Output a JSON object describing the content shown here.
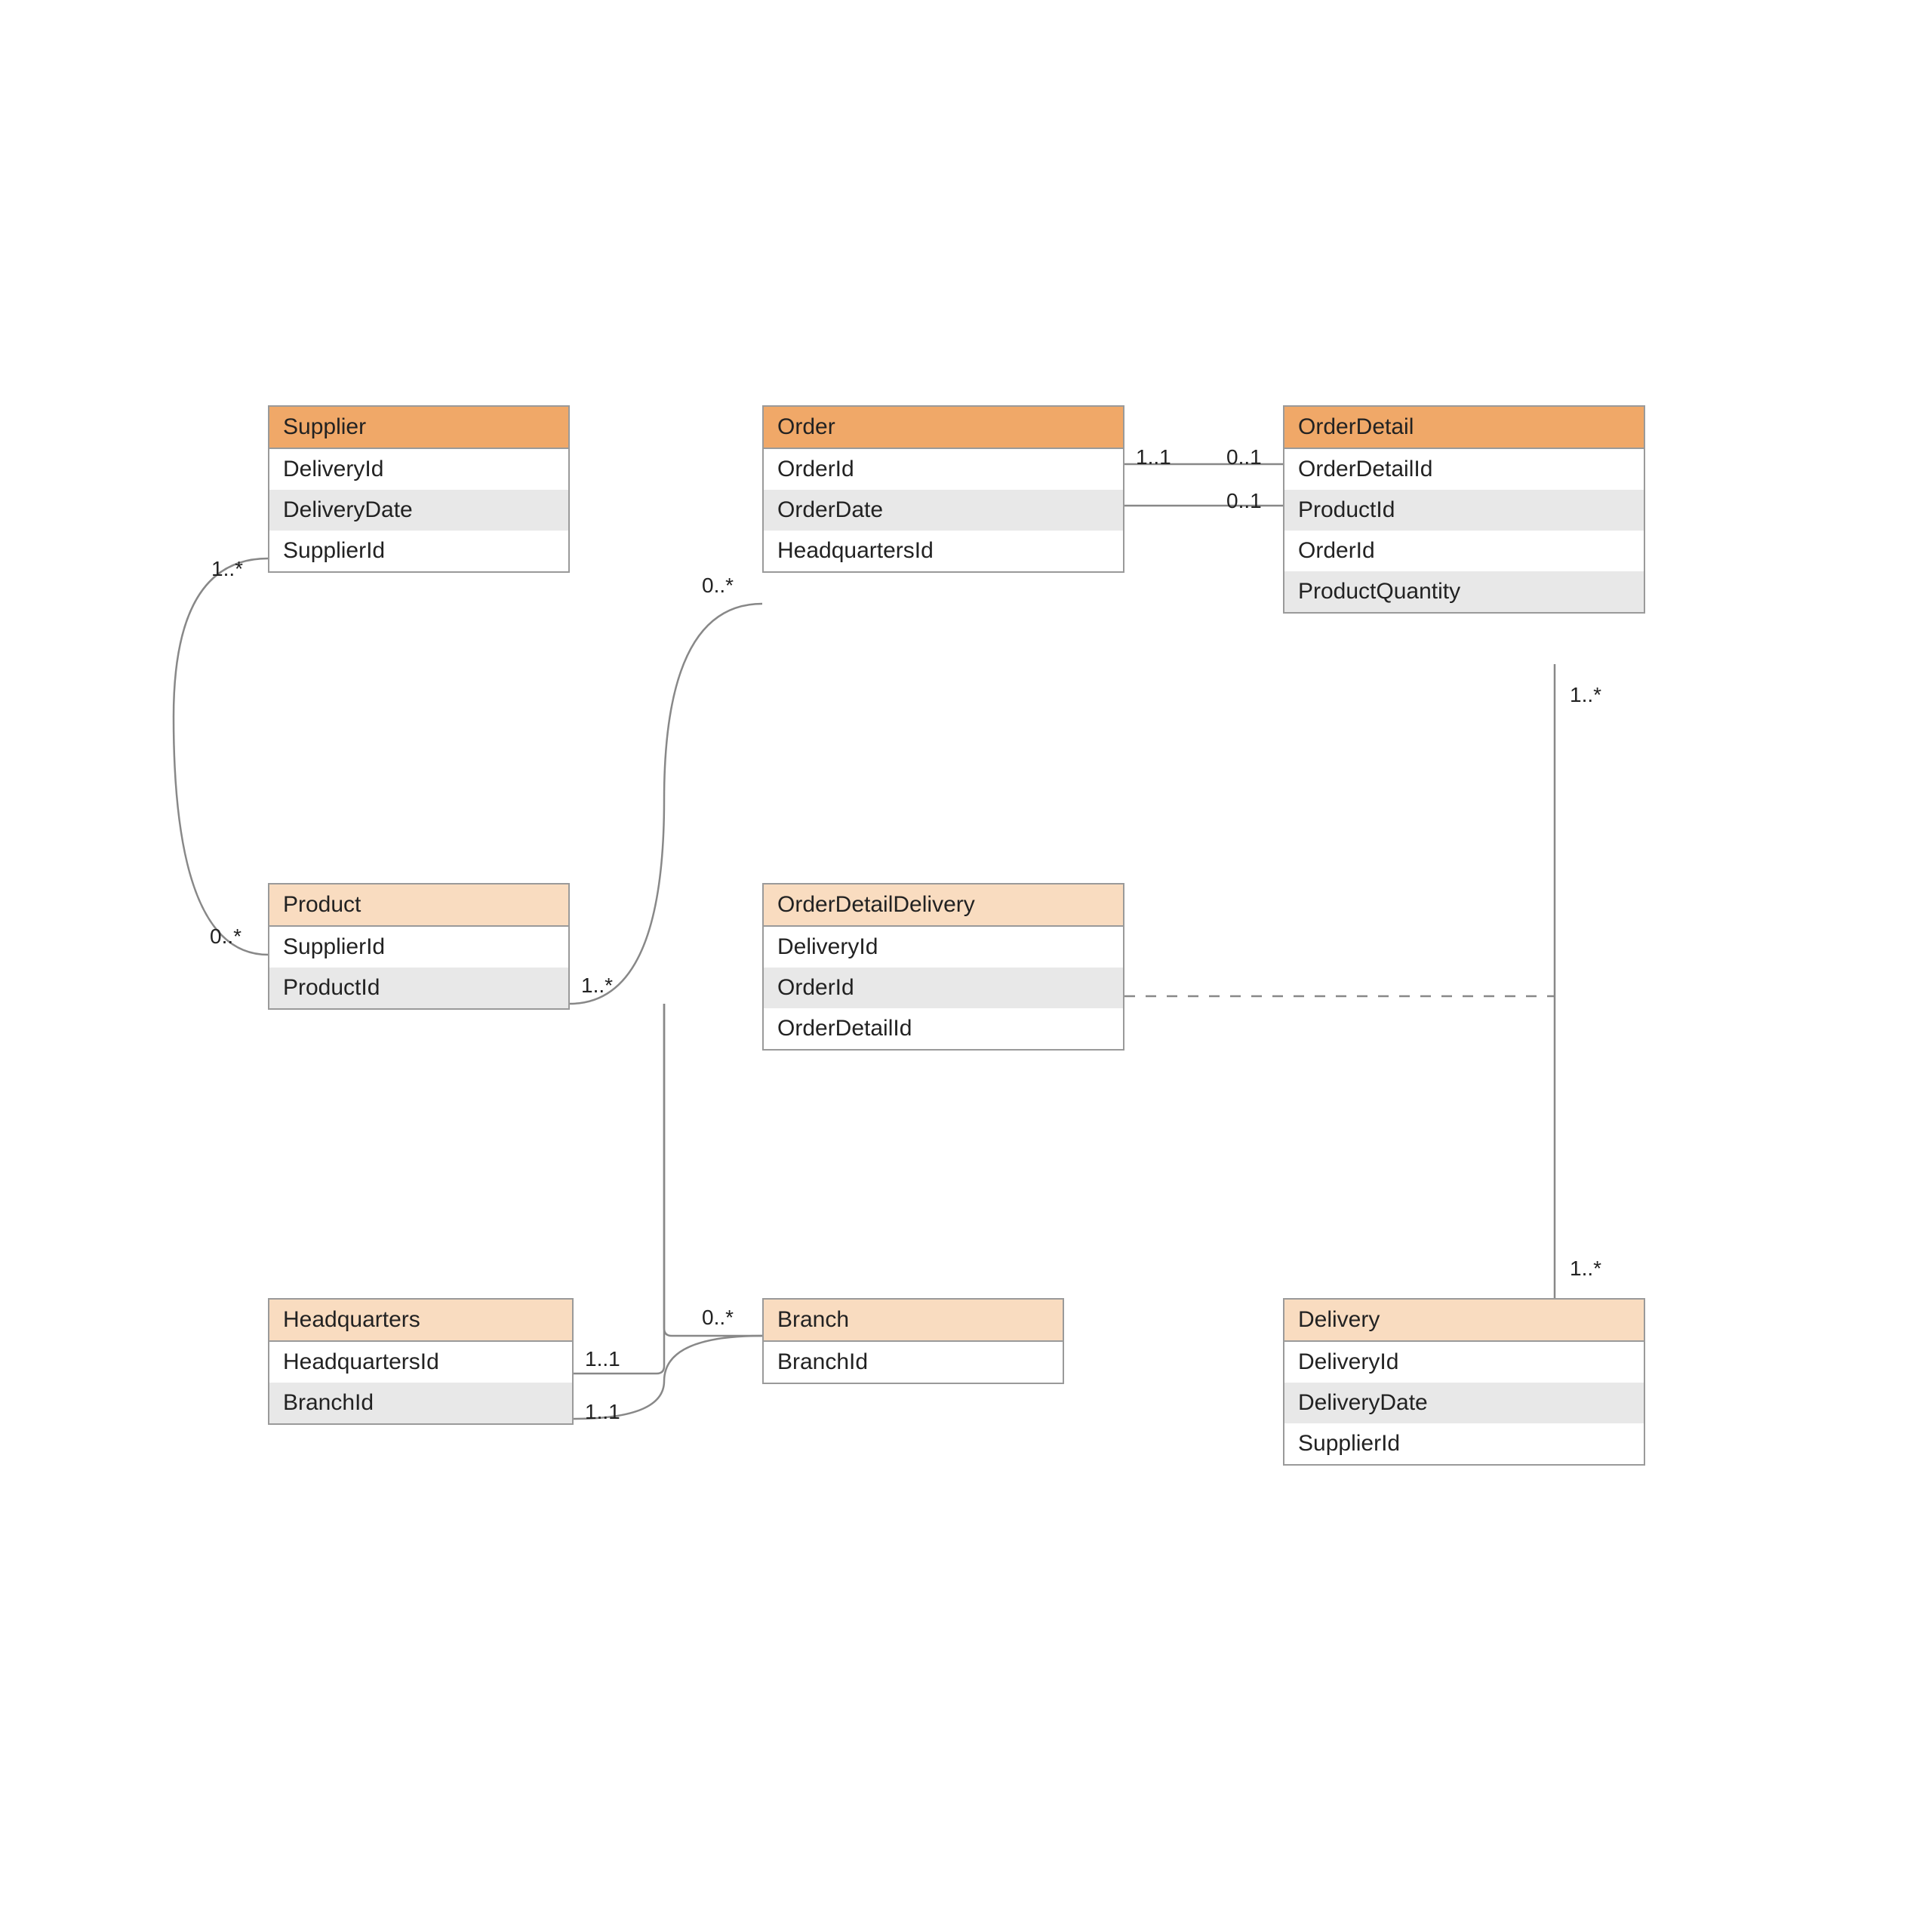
{
  "entities": {
    "supplier": {
      "title": "Supplier",
      "attrs": [
        "DeliveryId",
        "DeliveryDate",
        "SupplierId"
      ]
    },
    "order": {
      "title": "Order",
      "attrs": [
        "OrderId",
        "OrderDate",
        "HeadquartersId"
      ]
    },
    "orderDetail": {
      "title": "OrderDetail",
      "attrs": [
        "OrderDetailId",
        "ProductId",
        "OrderId",
        "ProductQuantity"
      ]
    },
    "product": {
      "title": "Product",
      "attrs": [
        "SupplierId",
        "ProductId"
      ]
    },
    "orderDetailDelivery": {
      "title": "OrderDetailDelivery",
      "attrs": [
        "DeliveryId",
        "OrderId",
        "OrderDetailId"
      ]
    },
    "headquarters": {
      "title": "Headquarters",
      "attrs": [
        "HeadquartersId",
        "BranchId"
      ]
    },
    "branch": {
      "title": "Branch",
      "attrs": [
        "BranchId"
      ]
    },
    "delivery": {
      "title": "Delivery",
      "attrs": [
        "DeliveryId",
        "DeliveryDate",
        "SupplierId"
      ]
    }
  },
  "multiplicities": {
    "supplier_product_1": "1..*",
    "supplier_product_2": "0..*",
    "product_order_1": "1..*",
    "product_order_2": "0..*",
    "order_orderDetail_1": "1..1",
    "order_orderDetail_2": "0..1",
    "order_orderDetail_3": "0..1",
    "orderDetail_delivery_1": "1..*",
    "orderDetail_delivery_2": "1..*",
    "headquarters_branch_1": "1..1",
    "headquarters_branch_2": "1..1",
    "headquarters_branch_3": "0..*"
  }
}
